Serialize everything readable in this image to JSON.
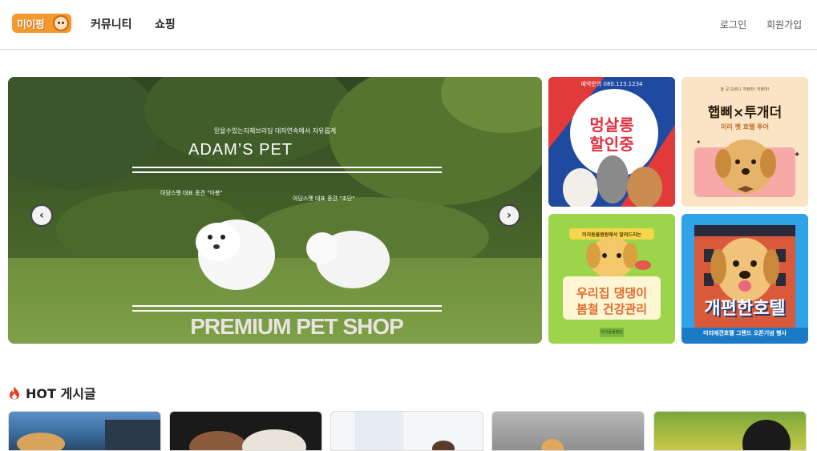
{
  "header": {
    "logo_text": "미이펑",
    "nav": [
      "커뮤니티",
      "쇼핑"
    ],
    "login": "로그인",
    "signup": "회원가입"
  },
  "hero": {
    "subtitle": "믿을수있는자체브리딩 대자연속에서 자유롭게",
    "title": "ADAM’S PET",
    "caption_left": "아담스펫 대표 종견 \"아봉\"",
    "caption_right": "아담스펫 대표 종견 \"조단\"",
    "bottom": "PREMIUM PET SHOP",
    "prev": "‹",
    "next": "›"
  },
  "promos": [
    {
      "top": "예약문의 080.123.1234",
      "main1": "멍살롱",
      "main2": "할인중"
    },
    {
      "top": "놀 곳 모르니 걱정마! 걱정마!",
      "main": "햅삐×투개더",
      "sub": "미리 펫 호텔 투어"
    },
    {
      "top": "미리동물병원에서 알려드리는",
      "main1": "우리집 댕댕이",
      "main2": "봄철 건강관리",
      "footer": "미리동물병원"
    },
    {
      "main": "개편한호텔",
      "sub": "미리애견호텔 그랜드 오픈기념 행사"
    }
  ],
  "hot": {
    "title": "HOT 게시글"
  },
  "colors": {
    "brand_orange": "#f49a2c",
    "fire": "#e8401c"
  }
}
